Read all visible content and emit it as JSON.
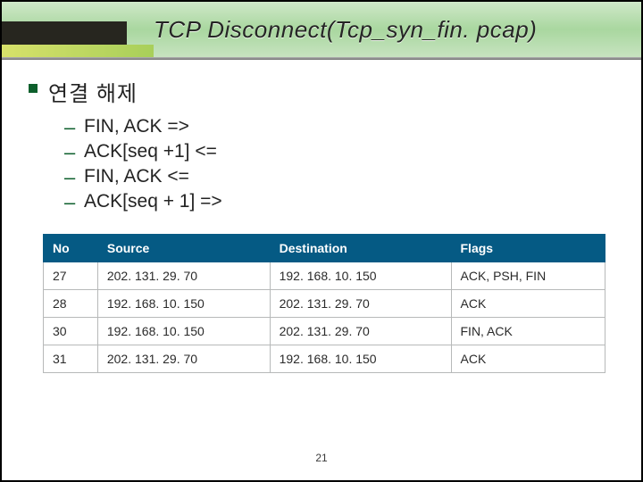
{
  "title": "TCP Disconnect(Tcp_syn_fin. pcap)",
  "section_title": "연결 해제",
  "steps": [
    "FIN, ACK   =>",
    "ACK[seq +1]  <=",
    "FIN, ACK <=",
    "ACK[seq + 1] =>"
  ],
  "table": {
    "headers": {
      "no": "No",
      "source": "Source",
      "destination": "Destination",
      "flags": "Flags"
    },
    "rows": [
      {
        "no": "27",
        "source": "202. 131. 29. 70",
        "destination": "192. 168. 10. 150",
        "flags": "ACK, PSH, FIN"
      },
      {
        "no": "28",
        "source": "192. 168. 10. 150",
        "destination": "202. 131. 29. 70",
        "flags": "ACK"
      },
      {
        "no": "30",
        "source": "192. 168. 10. 150",
        "destination": "202. 131. 29. 70",
        "flags": "FIN, ACK"
      },
      {
        "no": "31",
        "source": "202. 131. 29. 70",
        "destination": "192. 168. 10. 150",
        "flags": "ACK"
      }
    ]
  },
  "page_number": "21"
}
